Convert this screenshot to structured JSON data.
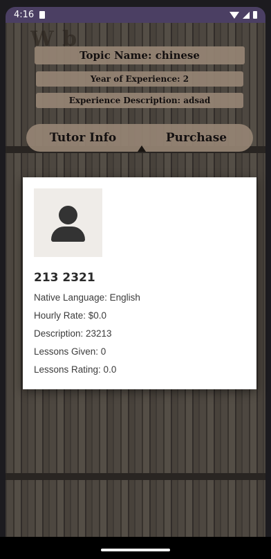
{
  "status_bar": {
    "time": "4:16",
    "icons": [
      "sd-card-icon",
      "wifi-icon",
      "signal-icon",
      "battery-icon"
    ]
  },
  "tutor_screen": {
    "heading": "W b",
    "topic": "Topic Name: chinese",
    "years": "Year of Experience: 2",
    "description": "Experience Description: adsad",
    "tabs": [
      {
        "label": "Tutor Info"
      },
      {
        "label": "Purchase"
      }
    ]
  },
  "dialog": {
    "avatar_icon": "person-icon",
    "name": "213 2321",
    "native_language": "Native Language: English",
    "hourly_rate": "Hourly Rate: $0.0",
    "description": "Description: 23213",
    "lessons_given": "Lessons Given: 0",
    "lessons_rating": "Lessons Rating: 0.0"
  },
  "colors": {
    "status_bar": "#4b3f63",
    "pill": "#968474",
    "dialog_bg": "#ffffff",
    "avatar_bg": "#efece8"
  }
}
